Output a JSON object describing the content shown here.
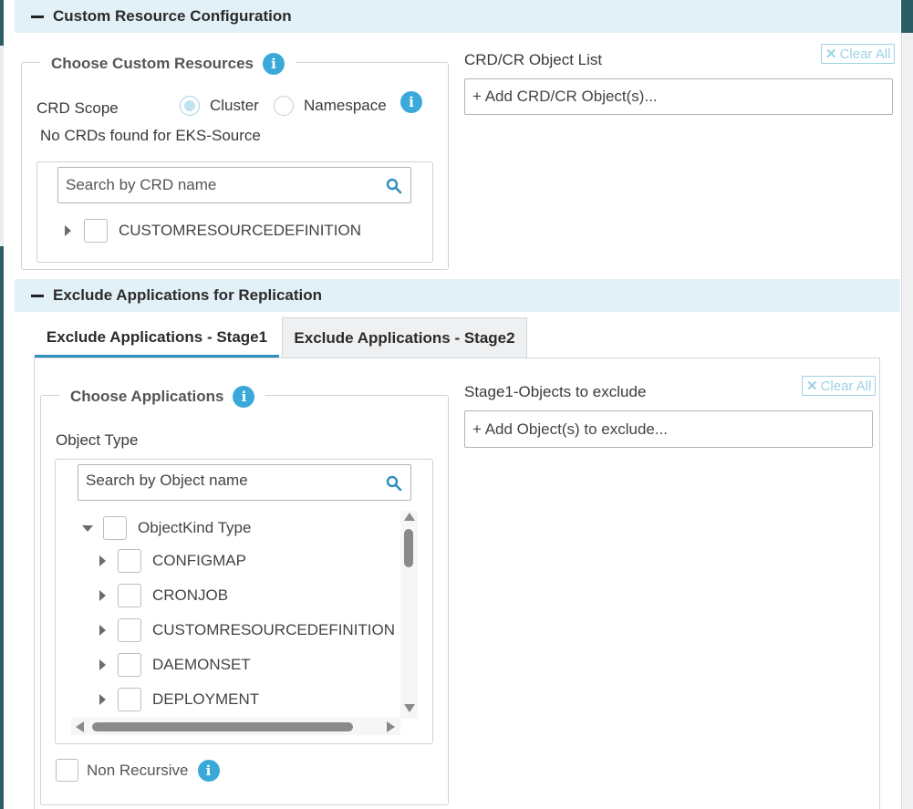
{
  "custom_resource": {
    "section_title": "Custom Resource Configuration",
    "choose_legend": "Choose Custom Resources",
    "crd_scope_label": "CRD Scope",
    "scope_options": [
      "Cluster",
      "Namespace"
    ],
    "selected_scope": "Cluster",
    "no_crds_message": "No CRDs found for EKS-Source",
    "search_placeholder": "Search by CRD name",
    "tree_item": "CUSTOMRESOURCEDEFINITION",
    "object_list_label": "CRD/CR Object List",
    "add_object_placeholder": "+ Add CRD/CR Object(s)...",
    "clear_all": "Clear All"
  },
  "exclude_apps": {
    "section_title": "Exclude Applications for Replication",
    "tabs": [
      "Exclude Applications - Stage1",
      "Exclude Applications - Stage2"
    ],
    "active_tab": "Exclude Applications - Stage1",
    "choose_legend": "Choose Applications",
    "object_type_label": "Object Type",
    "search_placeholder": "Search by Object name",
    "tree_root": "ObjectKind Type",
    "tree_items": [
      "CONFIGMAP",
      "CRONJOB",
      "CUSTOMRESOURCEDEFINITION",
      "DAEMONSET",
      "DEPLOYMENT"
    ],
    "non_recursive_label": "Non Recursive",
    "objects_label": "Stage1-Objects to exclude",
    "add_object_placeholder": "+ Add Object(s) to exclude...",
    "clear_all": "Clear All"
  },
  "icons": {
    "info": "i",
    "clear": "✕"
  },
  "colors": {
    "accent": "#3aa9d9",
    "section_bg": "#e2f1f7",
    "tab_underline": "#2f8fc0"
  }
}
